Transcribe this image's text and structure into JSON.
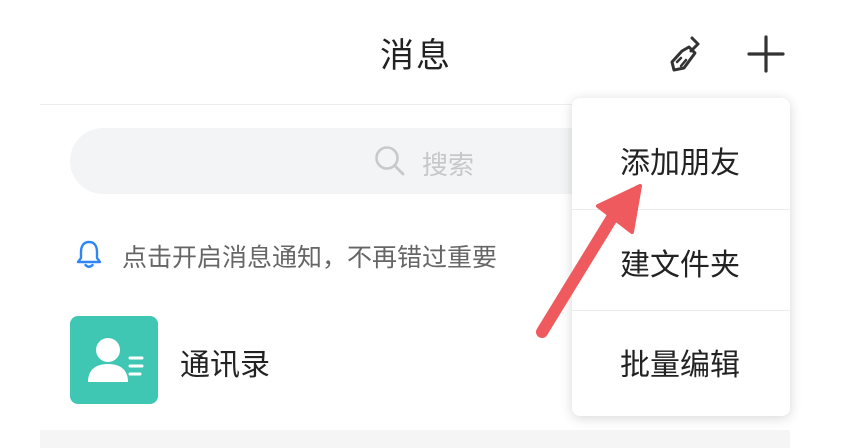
{
  "header": {
    "title": "消息",
    "clean_icon": "broom-icon",
    "add_icon": "plus-icon"
  },
  "search": {
    "placeholder": "搜索",
    "icon": "search-icon"
  },
  "notification": {
    "text": "点击开启消息通知，不再错过重要",
    "icon": "bell-icon"
  },
  "contacts": {
    "label": "通讯录",
    "icon": "contact-card-icon",
    "icon_color": "#3fc7b3"
  },
  "popup_menu": {
    "items": [
      {
        "label": "添加朋友"
      },
      {
        "label": "建文件夹"
      },
      {
        "label": "批量编辑"
      }
    ]
  },
  "annotation": {
    "arrow_color": "#ef5a5f",
    "target": "添加朋友"
  }
}
